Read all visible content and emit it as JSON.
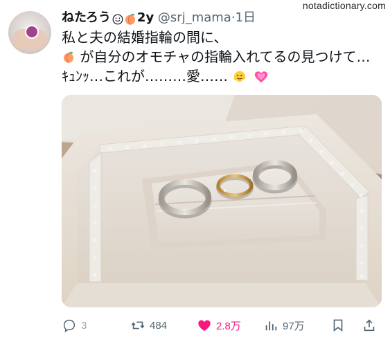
{
  "watermark": "notadictionary.com",
  "header": {
    "name": "ねたろう",
    "name_suffix": "2y",
    "handle": "@srj_mama",
    "separator": "·",
    "time": "1日"
  },
  "tweet": {
    "line1": "私と夫の結婚指輪の間に、",
    "line2": "が自分のオモチャの指輪入れてるの見つけて…",
    "line3": "ｷｭﾝｯ…これが………愛……"
  },
  "icons": {
    "avatar": "profile-photo-avatar",
    "name_emoji_1": "smiling-face-icon",
    "name_emoji_2": "peach-icon",
    "line2_emoji": "peach-icon",
    "line3_emoji_1": "melting-face-icon",
    "line3_emoji_2": "growing-heart-icon"
  },
  "image": {
    "alt": "ring box photo"
  },
  "actions": {
    "reply_count": "3",
    "retweet_count": "484",
    "like_count": "2.8万",
    "views_count": "97万"
  },
  "colors": {
    "text": "#0f1419",
    "secondary": "#536471",
    "like": "#f91880",
    "heart_emoji": "#ff4fa8"
  }
}
